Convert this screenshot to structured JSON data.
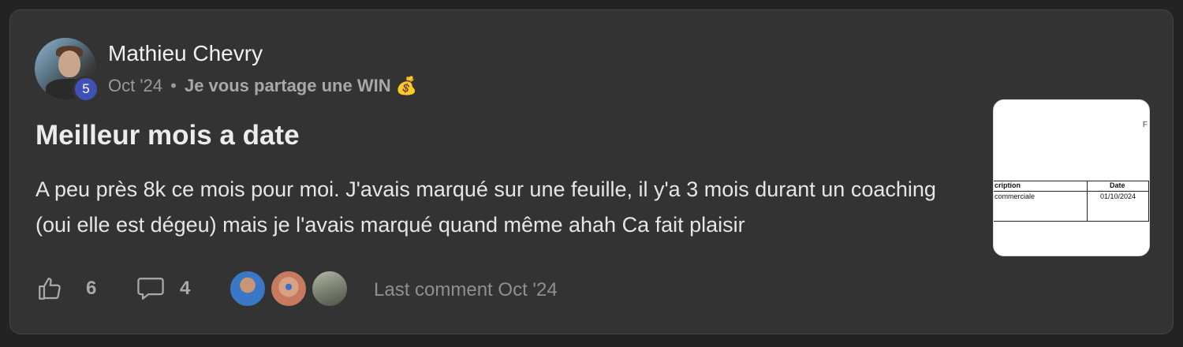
{
  "post": {
    "author": "Mathieu Chevry",
    "level": "5",
    "date": "Oct '24",
    "separator": "•",
    "category": "Je vous partage une WIN",
    "category_emoji": "💰",
    "title": "Meilleur mois a date",
    "body": "A peu près 8k ce mois pour moi. J'avais marqué sur une feuille, il y'a 3 mois durant un coaching (oui elle est dégeu) mais je l'avais marqué quand même ahah Ca fait plaisir"
  },
  "thumbnail": {
    "corner_mark": "F",
    "col1_header": "cription",
    "col2_header": "Date",
    "col1_value": "commerciale",
    "col2_value": "01/10/2024"
  },
  "actions": {
    "likes": "6",
    "comments": "4",
    "like_icon": "thumbs-up-icon",
    "comment_icon": "comment-bubble-icon"
  },
  "footer": {
    "last_comment": "Last comment Oct '24"
  }
}
